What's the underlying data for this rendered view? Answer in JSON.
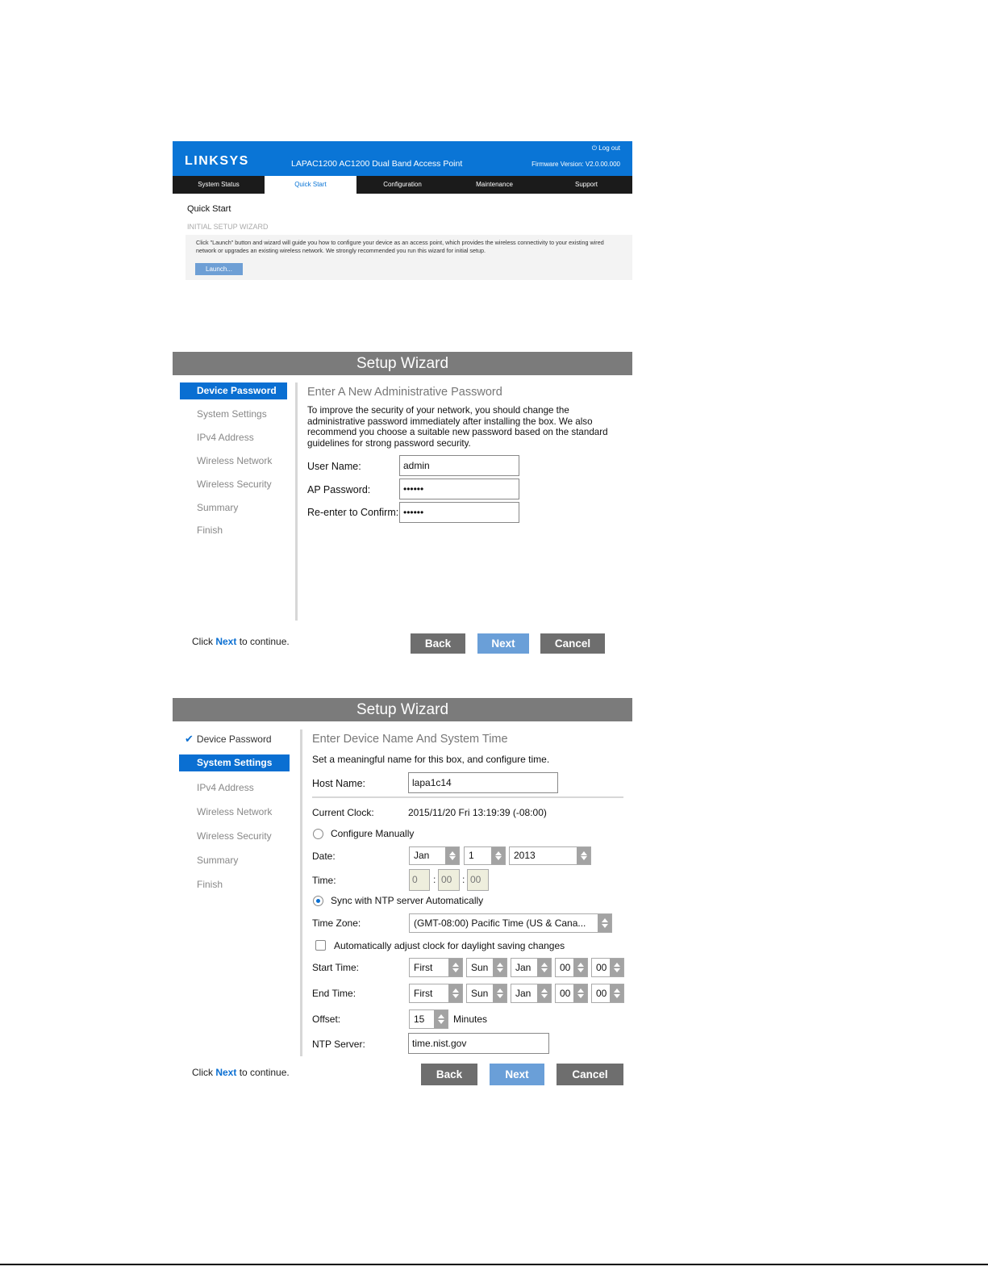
{
  "router": {
    "logo": "LINKSYS",
    "product": "LAPAC1200 AC1200 Dual Band Access Point",
    "logout": "Log out",
    "firmware": "Firmware Version: V2.0.00.000",
    "nav": [
      "System Status",
      "Quick Start",
      "Configuration",
      "Maintenance",
      "Support"
    ],
    "page_title": "Quick Start",
    "section": "INITIAL SETUP WIZARD",
    "description": "Click \"Launch\" button and wizard will guide you how to configure your device as an access point, which provides the wireless connectivity to your existing wired network or upgrades an existing wireless network. We strongly recommended you run this wizard for initial setup.",
    "launch": "Launch..."
  },
  "wizard1": {
    "title": "Setup Wizard",
    "steps": [
      "Device Password",
      "System Settings",
      "IPv4 Address",
      "Wireless Network",
      "Wireless Security",
      "Summary",
      "Finish"
    ],
    "heading": "Enter A New Administrative Password",
    "intro": "To improve the security of your network, you should change the administrative password immediately after installing the box. We also recommend you choose a suitable new password based on the standard guidelines for strong password security.",
    "fields": {
      "user_label": "User Name:",
      "user_value": "admin",
      "pass_label": "AP Password:",
      "pass_value": "••••••",
      "confirm_label": "Re-enter to Confirm:",
      "confirm_value": "••••••"
    },
    "hint_pre": "Click ",
    "hint_link": "Next",
    "hint_post": " to continue.",
    "back": "Back",
    "next": "Next",
    "cancel": "Cancel"
  },
  "wizard2": {
    "title": "Setup Wizard",
    "steps": [
      "Device Password",
      "System Settings",
      "IPv4 Address",
      "Wireless Network",
      "Wireless Security",
      "Summary",
      "Finish"
    ],
    "check": "✔",
    "heading": "Enter Device Name And System Time",
    "intro": "Set a meaningful name for this box, and configure time.",
    "host_label": "Host Name:",
    "host_value": "lapa1c14",
    "clock_label": "Current Clock:",
    "clock_value": "2015/11/20 Fri 13:19:39 (-08:00)",
    "manual": "Configure Manually",
    "date_label": "Date:",
    "date_month": "Jan",
    "date_day": "1",
    "date_year": "2013",
    "time_label": "Time:",
    "time_h": "0",
    "time_m": "00",
    "time_s": "00",
    "sync": "Sync with NTP server Automatically",
    "tz_label": "Time Zone:",
    "tz_value": "(GMT-08:00) Pacific Time (US & Cana...",
    "dst": "Automatically adjust clock for daylight saving changes",
    "start_label": "Start Time:",
    "end_label": "End Time:",
    "dst_week": "First",
    "dst_day": "Sun",
    "dst_month": "Jan",
    "dst_hour": "00",
    "dst_min": "00",
    "offset_label": "Offset:",
    "offset_value": "15",
    "offset_unit": "Minutes",
    "ntp_label": "NTP Server:",
    "ntp_value": "time.nist.gov",
    "hint_pre": "Click ",
    "hint_link": "Next",
    "hint_post": " to continue.",
    "back": "Back",
    "next": "Next",
    "cancel": "Cancel"
  }
}
